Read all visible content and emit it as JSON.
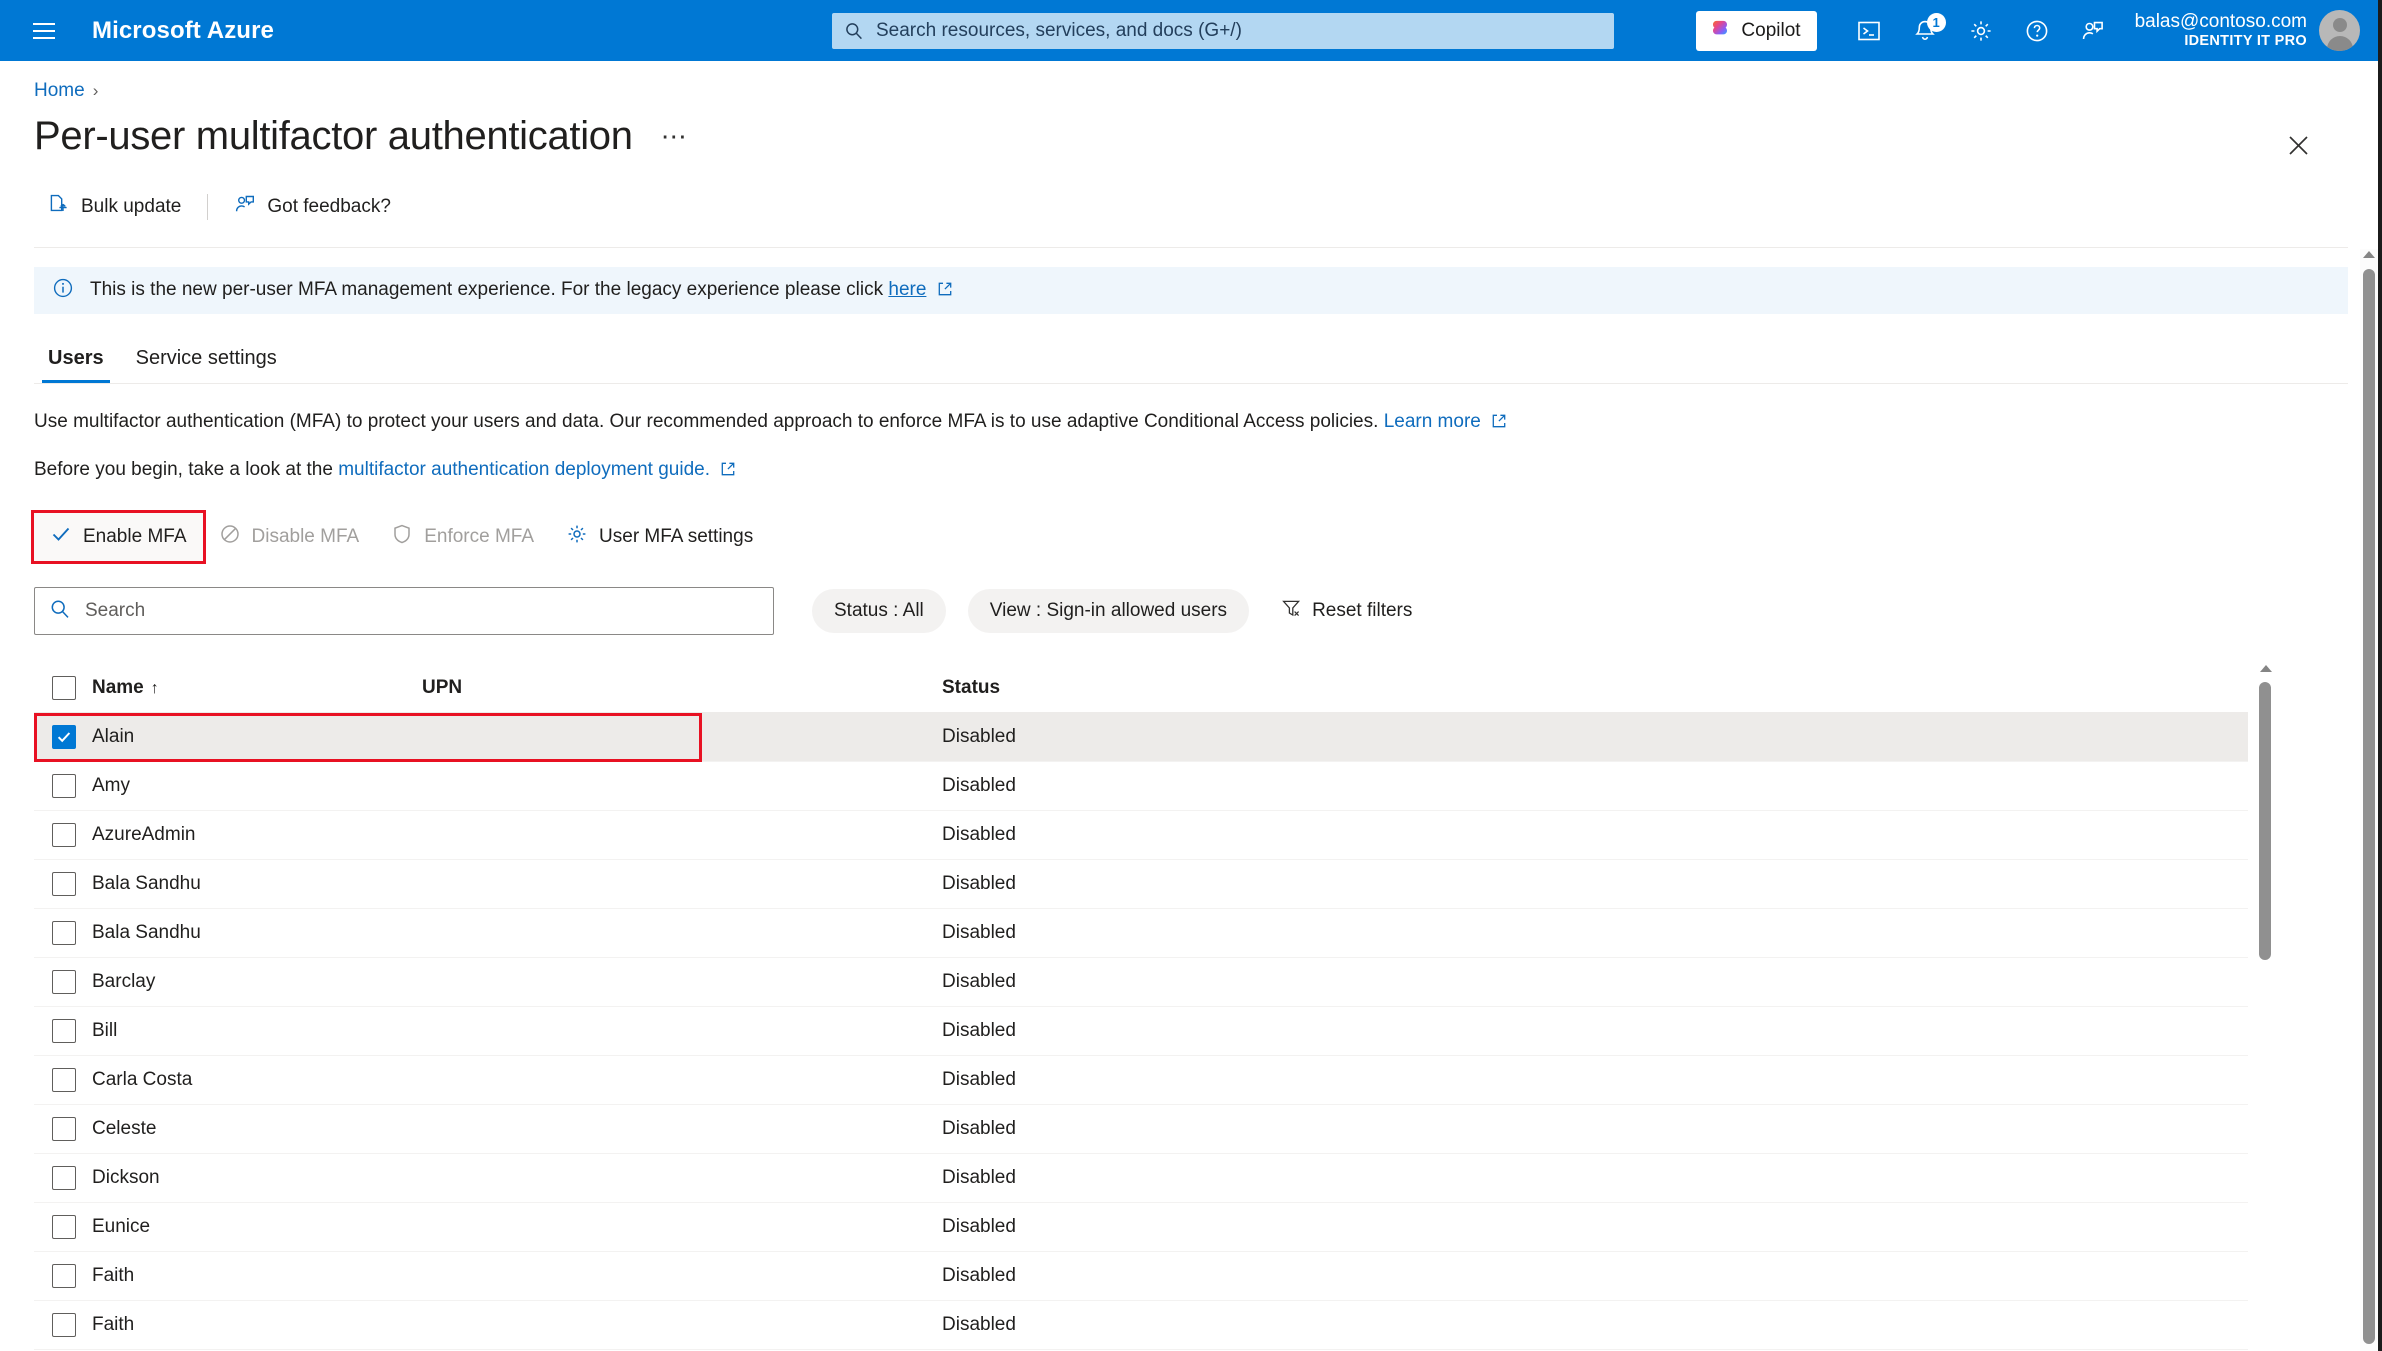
{
  "header": {
    "menu_icon": "hamburger-icon",
    "brand": "Microsoft Azure",
    "search_placeholder": "Search resources, services, and docs (G+/)",
    "copilot_label": "Copilot",
    "cloudshell_icon": "cloud-shell-icon",
    "notifications_icon": "bell-icon",
    "notifications_count": "1",
    "settings_icon": "gear-icon",
    "help_icon": "question-circle-icon",
    "feedback_icon": "person-feedback-icon",
    "account_email": "balas@contoso.com",
    "account_org": "IDENTITY IT PRO",
    "avatar": "user-avatar"
  },
  "breadcrumb": {
    "home": "Home",
    "separator": "›"
  },
  "page": {
    "title": "Per-user multifactor authentication",
    "ellipsis": "⋯",
    "close_icon": "close-icon"
  },
  "toolbar": {
    "bulk_update": "Bulk update",
    "bulk_update_icon": "bulk-upload-icon",
    "got_feedback": "Got feedback?",
    "got_feedback_icon": "person-feedback-icon"
  },
  "infobar": {
    "icon": "info-circle-icon",
    "text_before": "This is the new per-user MFA management experience. For the legacy experience please click ",
    "link": "here",
    "external_icon": "external-link-icon"
  },
  "tabs": [
    {
      "label": "Users",
      "active": true
    },
    {
      "label": "Service settings",
      "active": false
    }
  ],
  "description": {
    "line1_before": "Use multifactor authentication (MFA) to protect your users and data. Our recommended approach to enforce MFA is to use adaptive Conditional Access policies. ",
    "line1_link": "Learn more",
    "line2_before": "Before you begin, take a look at the ",
    "line2_link": "multifactor authentication deployment guide.",
    "external_icon": "external-link-icon"
  },
  "commands": [
    {
      "label": "Enable MFA",
      "icon": "checkmark-icon",
      "disabled": false,
      "highlighted": true
    },
    {
      "label": "Disable MFA",
      "icon": "block-circle-icon",
      "disabled": true,
      "highlighted": false
    },
    {
      "label": "Enforce MFA",
      "icon": "shield-icon",
      "disabled": true,
      "highlighted": false
    },
    {
      "label": "User MFA settings",
      "icon": "gear-icon",
      "disabled": false,
      "highlighted": false
    }
  ],
  "filters": {
    "search_placeholder": "Search",
    "search_value": "",
    "search_icon": "search-icon",
    "status_pill": "Status : All",
    "view_pill": "View : Sign-in allowed users",
    "reset_label": "Reset filters",
    "reset_icon": "filter-clear-icon"
  },
  "table": {
    "columns": {
      "name": "Name",
      "name_sort": "↑",
      "upn": "UPN",
      "status": "Status"
    },
    "rows": [
      {
        "name": "Alain",
        "upn": "",
        "status": "Disabled",
        "selected": true
      },
      {
        "name": "Amy",
        "upn": "",
        "status": "Disabled",
        "selected": false
      },
      {
        "name": "AzureAdmin",
        "upn": "",
        "status": "Disabled",
        "selected": false
      },
      {
        "name": "Bala Sandhu",
        "upn": "",
        "status": "Disabled",
        "selected": false
      },
      {
        "name": "Bala Sandhu",
        "upn": "",
        "status": "Disabled",
        "selected": false
      },
      {
        "name": "Barclay",
        "upn": "",
        "status": "Disabled",
        "selected": false
      },
      {
        "name": "Bill",
        "upn": "",
        "status": "Disabled",
        "selected": false
      },
      {
        "name": "Carla Costa",
        "upn": "",
        "status": "Disabled",
        "selected": false
      },
      {
        "name": "Celeste",
        "upn": "",
        "status": "Disabled",
        "selected": false
      },
      {
        "name": "Dickson",
        "upn": "",
        "status": "Disabled",
        "selected": false
      },
      {
        "name": "Eunice",
        "upn": "",
        "status": "Disabled",
        "selected": false
      },
      {
        "name": "Faith",
        "upn": "",
        "status": "Disabled",
        "selected": false
      },
      {
        "name": "Faith",
        "upn": "",
        "status": "Disabled",
        "selected": false
      }
    ]
  },
  "colors": {
    "azure_blue": "#0078d4",
    "link_blue": "#0f6cbd",
    "annotation_red": "#e81123",
    "info_bg": "#eff6fc",
    "selected_row": "#edebe9",
    "pill_bg": "#f3f2f1"
  }
}
